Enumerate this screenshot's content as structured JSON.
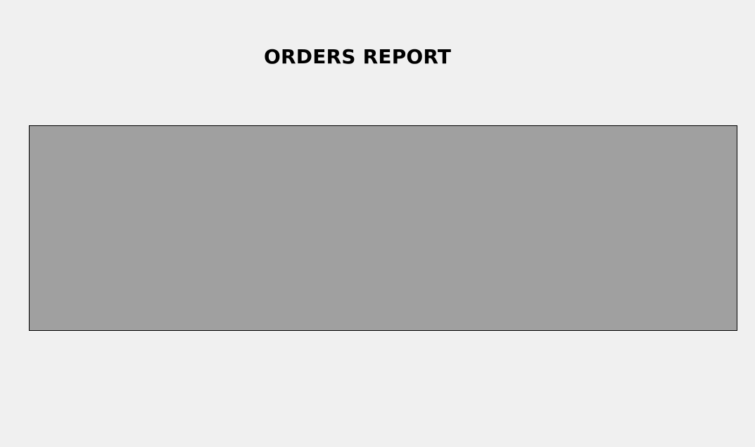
{
  "window": {
    "background": "#f0f0f0"
  },
  "report": {
    "title": "ORDERS REPORT"
  },
  "grid": {
    "background": "#a0a0a0",
    "border_color": "#000000"
  }
}
